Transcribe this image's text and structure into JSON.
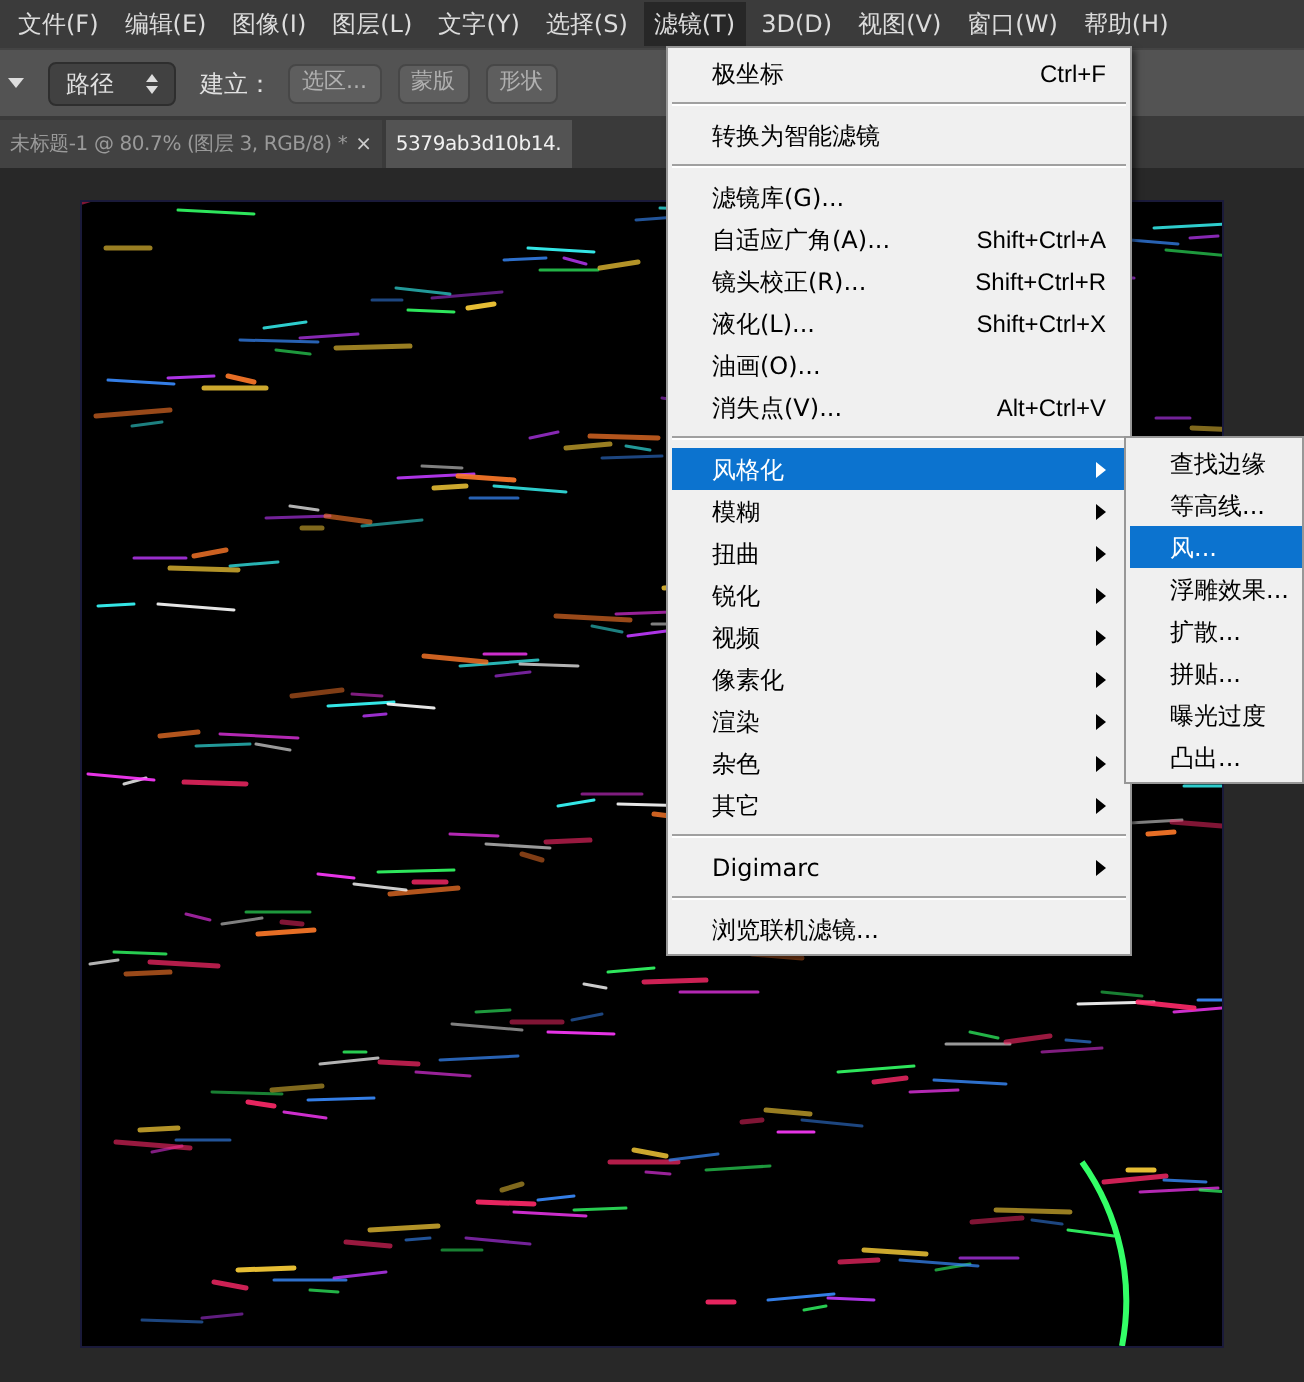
{
  "menu_bar": [
    {
      "label": "文件(F)",
      "selected": false
    },
    {
      "label": "编辑(E)",
      "selected": false
    },
    {
      "label": "图像(I)",
      "selected": false
    },
    {
      "label": "图层(L)",
      "selected": false
    },
    {
      "label": "文字(Y)",
      "selected": false
    },
    {
      "label": "选择(S)",
      "selected": false
    },
    {
      "label": "滤镜(T)",
      "selected": true
    },
    {
      "label": "3D(D)",
      "selected": false
    },
    {
      "label": "视图(V)",
      "selected": false
    },
    {
      "label": "窗口(W)",
      "selected": false
    },
    {
      "label": "帮助(H)",
      "selected": false
    }
  ],
  "options_bar": {
    "mode": "路径",
    "build_label": "建立：",
    "buttons": [
      "选区...",
      "蒙版",
      "形状"
    ]
  },
  "document_tabs": [
    {
      "label": "未标题-1 @ 80.7% (图层 3, RGB/8) *",
      "close": "×",
      "selected": false
    },
    {
      "label": "5379ab3d10b14.",
      "selected": true
    }
  ],
  "filter_menu": {
    "groups": [
      [
        {
          "label": "极坐标",
          "shortcut": "Ctrl+F",
          "submenu": false,
          "selected": false
        }
      ],
      [
        {
          "label": "转换为智能滤镜",
          "submenu": false,
          "selected": false
        }
      ],
      [
        {
          "label": "滤镜库(G)...",
          "submenu": false,
          "selected": false
        },
        {
          "label": "自适应广角(A)...",
          "shortcut": "Shift+Ctrl+A",
          "submenu": false,
          "selected": false
        },
        {
          "label": "镜头校正(R)...",
          "shortcut": "Shift+Ctrl+R",
          "submenu": false,
          "selected": false
        },
        {
          "label": "液化(L)...",
          "shortcut": "Shift+Ctrl+X",
          "submenu": false,
          "selected": false
        },
        {
          "label": "油画(O)...",
          "submenu": false,
          "selected": false
        },
        {
          "label": "消失点(V)...",
          "shortcut": "Alt+Ctrl+V",
          "submenu": false,
          "selected": false
        }
      ],
      [
        {
          "label": "风格化",
          "submenu": true,
          "selected": true
        },
        {
          "label": "模糊",
          "submenu": true,
          "selected": false
        },
        {
          "label": "扭曲",
          "submenu": true,
          "selected": false
        },
        {
          "label": "锐化",
          "submenu": true,
          "selected": false
        },
        {
          "label": "视频",
          "submenu": true,
          "selected": false
        },
        {
          "label": "像素化",
          "submenu": true,
          "selected": false
        },
        {
          "label": "渲染",
          "submenu": true,
          "selected": false
        },
        {
          "label": "杂色",
          "submenu": true,
          "selected": false
        },
        {
          "label": "其它",
          "submenu": true,
          "selected": false
        }
      ],
      [
        {
          "label": "Digimarc",
          "submenu": true,
          "selected": false
        }
      ],
      [
        {
          "label": "浏览联机滤镜...",
          "submenu": false,
          "selected": false
        }
      ]
    ]
  },
  "stylize_submenu": [
    {
      "label": "查找边缘",
      "selected": false
    },
    {
      "label": "等高线...",
      "selected": false
    },
    {
      "label": "风...",
      "selected": true
    },
    {
      "label": "浮雕效果...",
      "selected": false
    },
    {
      "label": "扩散...",
      "selected": false
    },
    {
      "label": "拼贴...",
      "selected": false
    },
    {
      "label": "曝光过度",
      "selected": false
    },
    {
      "label": "凸出...",
      "selected": false
    }
  ]
}
